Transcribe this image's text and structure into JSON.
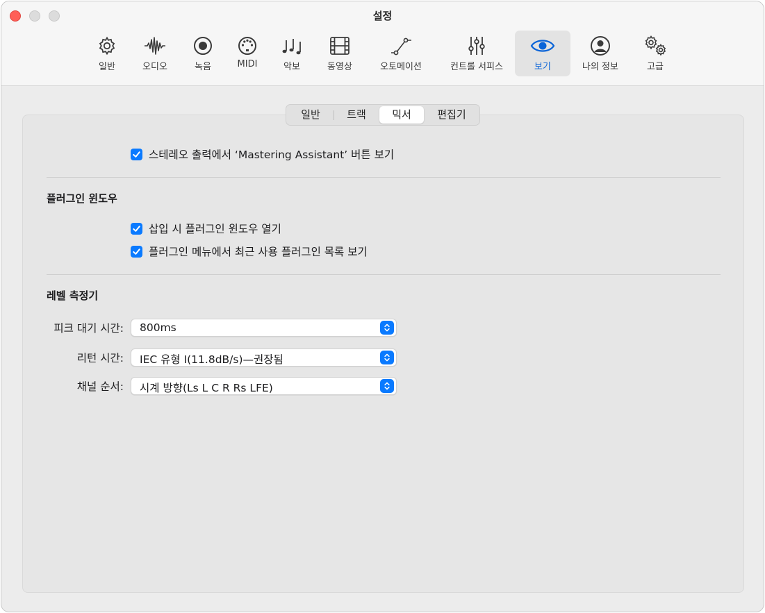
{
  "window": {
    "title": "설정"
  },
  "toolbar": {
    "items": [
      {
        "label": "일반",
        "icon": "gear-icon"
      },
      {
        "label": "오디오",
        "icon": "waveform-icon"
      },
      {
        "label": "녹음",
        "icon": "record-icon"
      },
      {
        "label": "MIDI",
        "icon": "midi-port-icon"
      },
      {
        "label": "악보",
        "icon": "music-notes-icon"
      },
      {
        "label": "동영상",
        "icon": "film-icon"
      },
      {
        "label": "오토메이션",
        "icon": "automation-curve-icon"
      },
      {
        "label": "컨트롤 서피스",
        "icon": "sliders-icon"
      },
      {
        "label": "보기",
        "icon": "eye-icon"
      },
      {
        "label": "나의 정보",
        "icon": "person-icon"
      },
      {
        "label": "고급",
        "icon": "gears-icon"
      }
    ],
    "active": "보기"
  },
  "tabs": {
    "items": [
      "일반",
      "트랙",
      "믹서",
      "편집기"
    ],
    "selected": "믹서"
  },
  "mixer": {
    "mastering_checkbox": {
      "label": "스테레오 출력에서 ‘Mastering Assistant’ 버튼 보기",
      "checked": true
    },
    "plugin_section": {
      "title": "플러그인 윈도우",
      "open_on_insert": {
        "label": "삽입 시 플러그인 윈도우 열기",
        "checked": true
      },
      "recent_plugins": {
        "label": "플러그인 메뉴에서 최근 사용 플러그인 목록 보기",
        "checked": true
      }
    },
    "meter_section": {
      "title": "레벨 측정기",
      "peak_hold": {
        "label": "피크 대기 시간:",
        "value": "800ms"
      },
      "return_time": {
        "label": "리턴 시간:",
        "value": "IEC 유형 I(11.8dB/s)—권장됨"
      },
      "channel_order": {
        "label": "채널 순서:",
        "value": "시계 방향(Ls L C R Rs LFE)"
      }
    }
  },
  "colors": {
    "accent": "#0a7aff",
    "close": "#ff5f57",
    "active_label": "#0a64d8"
  }
}
